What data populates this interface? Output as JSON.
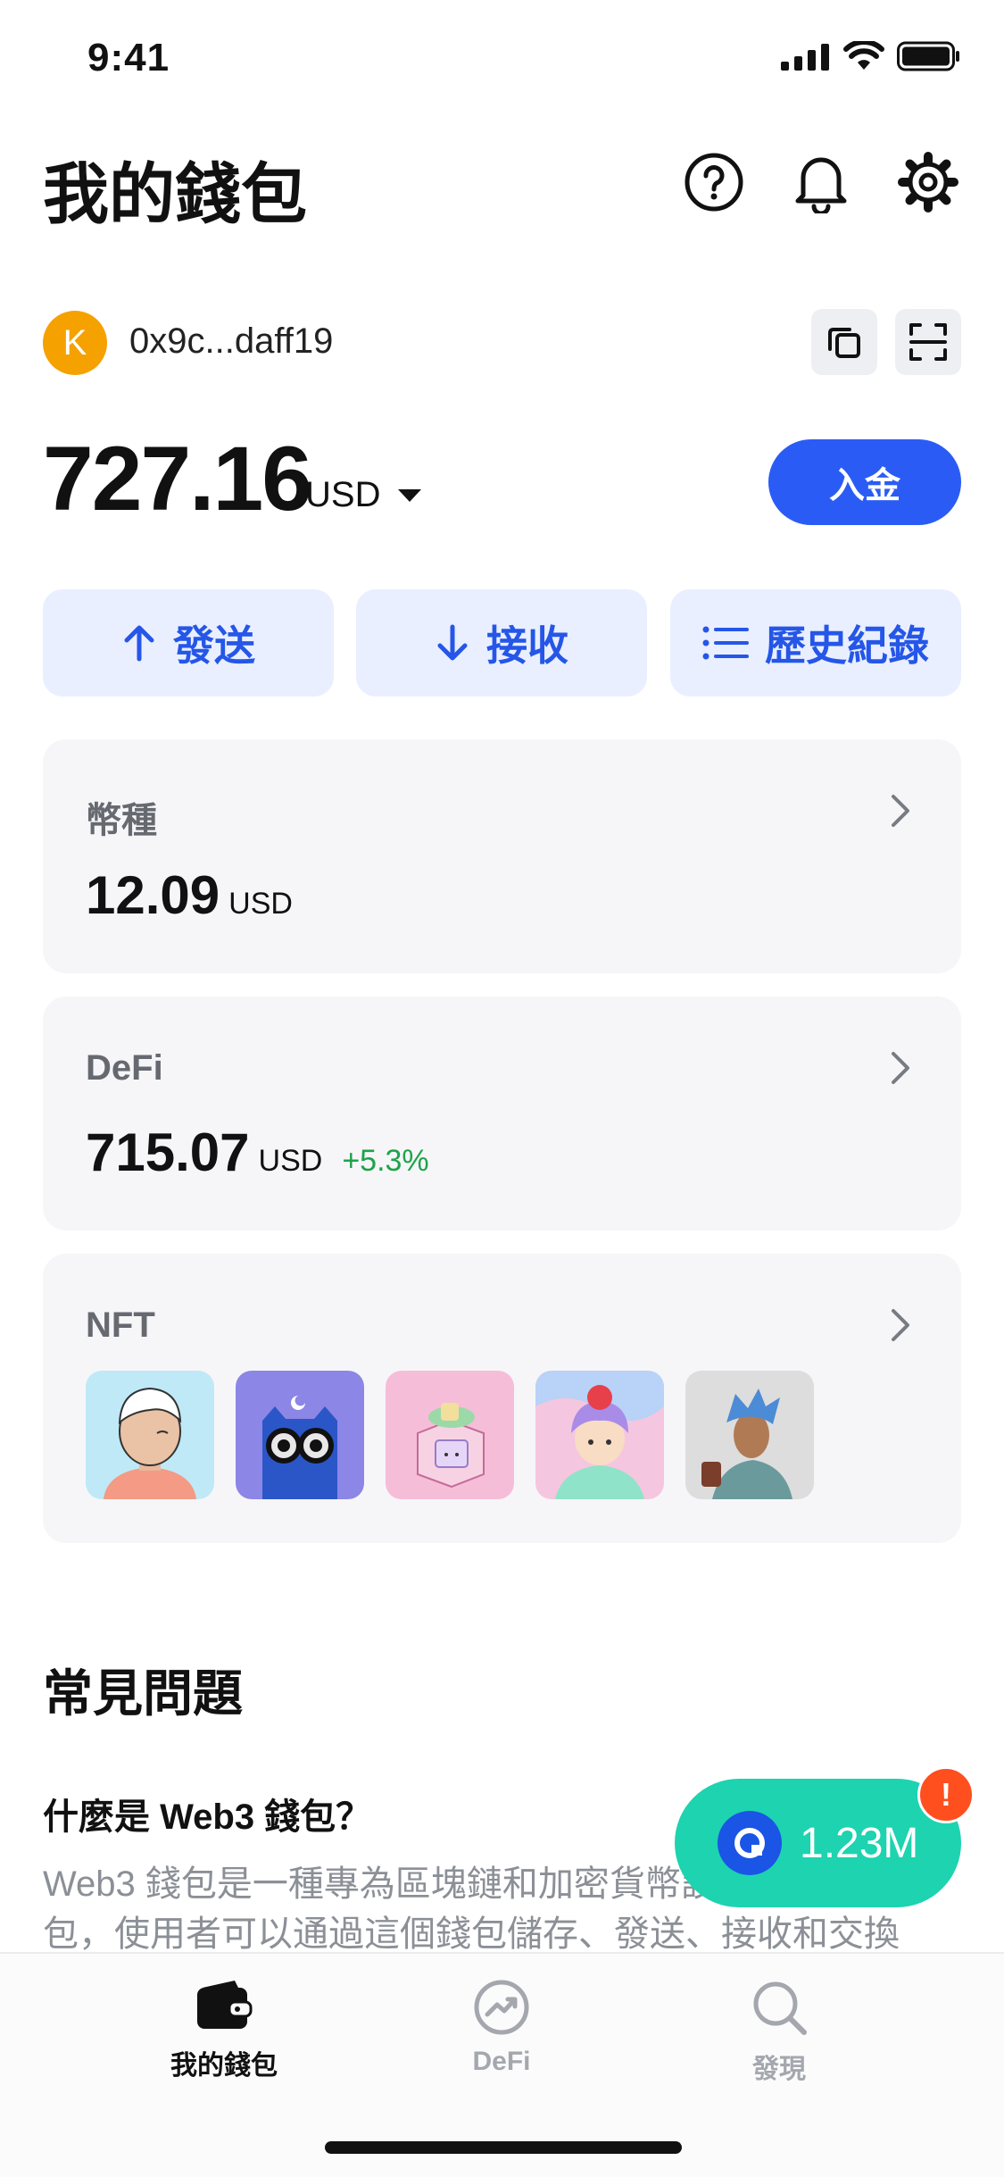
{
  "status_bar": {
    "time": "9:41"
  },
  "header": {
    "title": "我的錢包"
  },
  "account": {
    "avatar_letter": "K",
    "address": "0x9c...daff19"
  },
  "balance": {
    "amount": "727.16",
    "currency": "USD",
    "deposit_label": "入金"
  },
  "actions": [
    {
      "label": "發送",
      "icon": "arrow-up-icon"
    },
    {
      "label": "接收",
      "icon": "arrow-down-icon"
    },
    {
      "label": "歷史紀錄",
      "icon": "list-icon"
    }
  ],
  "cards": {
    "tokens": {
      "label": "幣種",
      "value": "12.09",
      "unit": "USD"
    },
    "defi": {
      "label": "DeFi",
      "value": "715.07",
      "unit": "USD",
      "change": "+5.3%"
    },
    "nft": {
      "label": "NFT"
    }
  },
  "faq": {
    "title": "常見問題",
    "question": "什麼是 Web3 錢包？",
    "answer_line1": "Web3 錢包是一種專為區塊鏈和加密貨幣設計的錢",
    "answer_line2": "包，使用者可以通過這個錢包儲存、發送、接收和交換"
  },
  "floating": {
    "value": "1.23M",
    "badge": "!"
  },
  "tabs": [
    {
      "label": "我的錢包",
      "icon": "wallet-icon",
      "active": true
    },
    {
      "label": "DeFi",
      "icon": "trend-icon",
      "active": false
    },
    {
      "label": "發現",
      "icon": "search-icon",
      "active": false
    }
  ],
  "colors": {
    "accent": "#2a5cf5",
    "positive": "#1ea34a",
    "teal": "#1dd3b0",
    "avatar": "#f5a100"
  }
}
